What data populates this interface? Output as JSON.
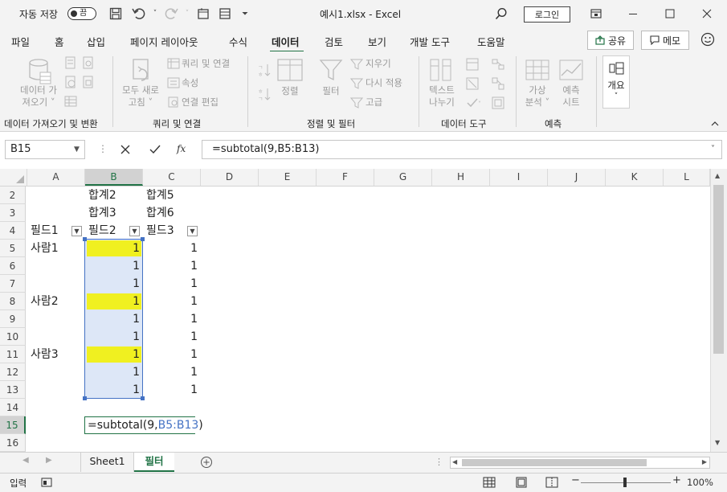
{
  "titlebar": {
    "autosave_label": "자동 저장",
    "autosave_state": "끔",
    "window_title": "예시1.xlsx  -  Excel",
    "login_label": "로그인"
  },
  "menu": {
    "tabs": [
      "파일",
      "홈",
      "삽입",
      "페이지 레이아웃",
      "수식",
      "데이터",
      "검토",
      "보기",
      "개발 도구",
      "도움말"
    ],
    "active_tab": "데이터",
    "share_label": "공유",
    "memo_label": "메모"
  },
  "ribbon": {
    "get_data": [
      "데이터 가",
      "져오기 ˅"
    ],
    "refresh_all": [
      "모두 새로",
      "고침 ˅"
    ],
    "queries_connections": "쿼리 및 연결",
    "properties": "속성",
    "edit_links": "연결 편집",
    "sort": "정렬",
    "filter": "필터",
    "clear": "지우기",
    "reapply": "다시 적용",
    "advanced": "고급",
    "text_to_columns": [
      "텍스트",
      "나누기"
    ],
    "what_if": [
      "가상",
      "분석 ˅"
    ],
    "forecast_sheet": [
      "예측",
      "시트"
    ],
    "outline": "개요",
    "groups": {
      "get_transform": "데이터 가져오기 및 변환",
      "queries": "쿼리 및 연결",
      "sort_filter": "정렬 및 필터",
      "data_tools": "데이터 도구",
      "forecast": "예측"
    }
  },
  "formula_bar": {
    "name_box": "B15",
    "formula": "=subtotal(9,B5:B13)"
  },
  "grid": {
    "columns": [
      "A",
      "B",
      "C",
      "D",
      "E",
      "F",
      "G",
      "H",
      "I",
      "J",
      "K",
      "L"
    ],
    "rows": [
      "2",
      "3",
      "4",
      "5",
      "6",
      "7",
      "8",
      "9",
      "10",
      "11",
      "12",
      "13",
      "14",
      "15",
      "16"
    ],
    "selected_column": "B",
    "selected_row": "15",
    "cells": {
      "B2": "합계2",
      "C2": "합계5",
      "B3": "합계3",
      "C3": "합계6",
      "A4": "필드1",
      "B4": "필드2",
      "C4": "필드3",
      "A5": "사람1",
      "A8": "사람2",
      "A11": "사람3",
      "B5": "1",
      "B6": "1",
      "B7": "1",
      "B8": "1",
      "B9": "1",
      "B10": "1",
      "B11": "1",
      "B12": "1",
      "B13": "1",
      "C5": "1",
      "C6": "1",
      "C7": "1",
      "C8": "1",
      "C9": "1",
      "C10": "1",
      "C11": "1",
      "C12": "1",
      "C13": "1"
    },
    "highlighted_cells": [
      "B5",
      "B8",
      "B11"
    ],
    "highlight_color": "#f0f020",
    "range_fill_color": "#dde7f7",
    "edit_cell": {
      "prefix": "=subtotal(9,",
      "ref": "B5:B13",
      "suffix": ")",
      "ref_color": "#4472c4"
    }
  },
  "sheets": {
    "tabs": [
      "Sheet1",
      "필터"
    ],
    "active": "필터"
  },
  "status": {
    "mode": "입력",
    "zoom": "100%"
  },
  "colors": {
    "accent": "#217346",
    "selection_border": "#4472c4"
  }
}
